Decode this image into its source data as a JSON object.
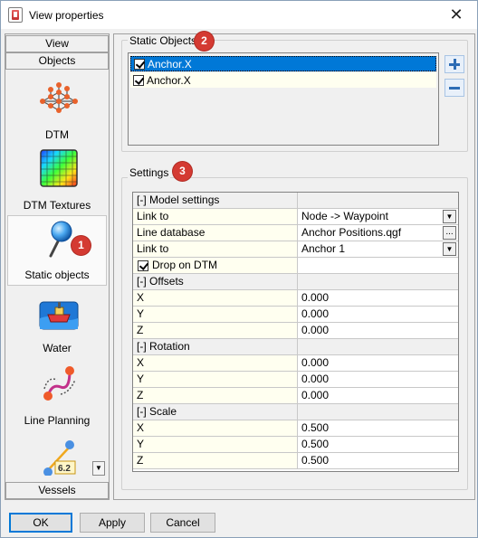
{
  "window": {
    "title": "View properties"
  },
  "left_panel": {
    "tabs": {
      "view": "View",
      "objects": "Objects",
      "vessels": "Vessels"
    },
    "items": [
      {
        "label": "DTM",
        "icon": "dtm-mesh-icon"
      },
      {
        "label": "DTM Textures",
        "icon": "dtm-textures-icon"
      },
      {
        "label": "Static objects",
        "icon": "static-objects-pin-icon"
      },
      {
        "label": "Water",
        "icon": "water-boat-icon"
      },
      {
        "label": "Line Planning",
        "icon": "line-planning-icon"
      },
      {
        "label": "",
        "icon": "measure-icon",
        "value_badge": "6.2"
      }
    ]
  },
  "static_objects": {
    "title": "Static Objects",
    "items": [
      {
        "label": "Anchor.X",
        "checked": true,
        "selected": true
      },
      {
        "label": "Anchor.X",
        "checked": true,
        "selected": false
      }
    ]
  },
  "settings": {
    "title": "Settings",
    "rows": [
      {
        "label": "[-] Model settings",
        "value": "",
        "section": true
      },
      {
        "label": "Link to",
        "value": "Node -> Waypoint",
        "control": "dropdown"
      },
      {
        "label": "Line database",
        "value": "Anchor Positions.qgf",
        "control": "browse"
      },
      {
        "label": "Link to",
        "value": "Anchor 1",
        "control": "dropdown"
      },
      {
        "label": "Drop on DTM",
        "value": "",
        "control": "checkbox",
        "checked": true
      },
      {
        "label": "[-] Offsets",
        "value": "",
        "section": true
      },
      {
        "label": "X",
        "value": "0.000"
      },
      {
        "label": "Y",
        "value": "0.000"
      },
      {
        "label": "Z",
        "value": "0.000"
      },
      {
        "label": "[-] Rotation",
        "value": "",
        "section": true
      },
      {
        "label": "X",
        "value": "0.000"
      },
      {
        "label": "Y",
        "value": "0.000"
      },
      {
        "label": "Z",
        "value": "0.000"
      },
      {
        "label": "[-] Scale",
        "value": "",
        "section": true
      },
      {
        "label": "X",
        "value": "0.500"
      },
      {
        "label": "Y",
        "value": "0.500"
      },
      {
        "label": "Z",
        "value": "0.500"
      }
    ],
    "browse_label": "..."
  },
  "badges": [
    "1",
    "2",
    "3"
  ],
  "buttons": {
    "ok": "OK",
    "apply": "Apply",
    "cancel": "Cancel"
  },
  "colors": {
    "selection": "#0078d7",
    "badge": "#d43a32",
    "row_label_bg": "#fffff0"
  }
}
